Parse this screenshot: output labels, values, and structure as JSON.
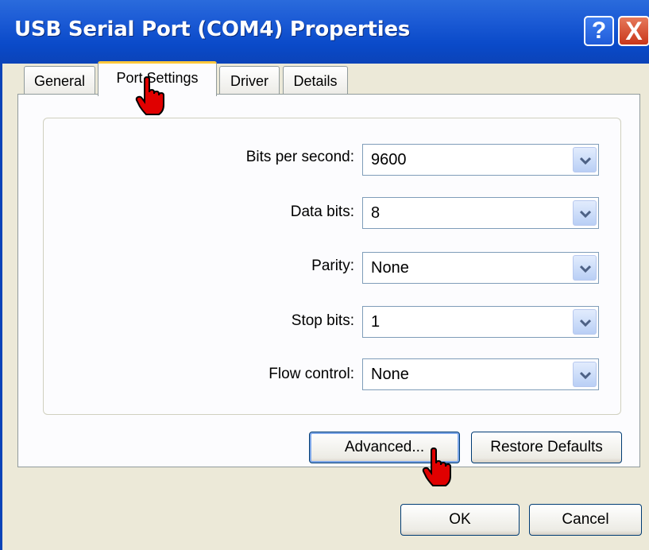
{
  "window": {
    "title": "USB Serial Port (COM4) Properties",
    "help_label": "?",
    "close_label": "X"
  },
  "tabs": [
    {
      "label": "General",
      "active": false
    },
    {
      "label": "Port Settings",
      "active": true
    },
    {
      "label": "Driver",
      "active": false
    },
    {
      "label": "Details",
      "active": false
    }
  ],
  "settings": {
    "bits_per_second": {
      "label": "Bits per second:",
      "value": "9600"
    },
    "data_bits": {
      "label": "Data bits:",
      "value": "8"
    },
    "parity": {
      "label": "Parity:",
      "value": "None"
    },
    "stop_bits": {
      "label": "Stop bits:",
      "value": "1"
    },
    "flow_control": {
      "label": "Flow control:",
      "value": "None"
    }
  },
  "buttons": {
    "advanced": "Advanced...",
    "restore_defaults": "Restore Defaults",
    "ok": "OK",
    "cancel": "Cancel"
  },
  "colors": {
    "titlebar": "#0a4ac9",
    "active_tab_highlight": "#ffc83c",
    "cursor": "#e00000"
  }
}
